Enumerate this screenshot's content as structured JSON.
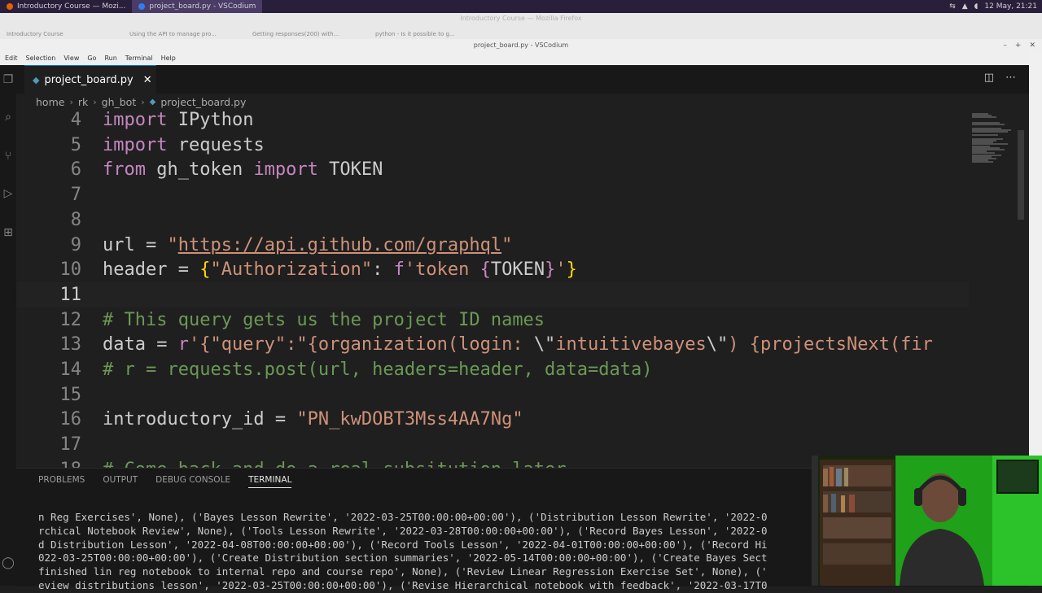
{
  "taskbar": {
    "tasks": [
      {
        "label": "Introductory Course — Mozi..."
      },
      {
        "label": "project_board.py - VSCodium"
      }
    ],
    "clock": "12 May, 21:21"
  },
  "firefox": {
    "title": "Introductory Course — Mozilla Firefox",
    "tabs": [
      {
        "label": "Introductory Course"
      },
      {
        "label": "Using the API to manage pro..."
      },
      {
        "label": "Getting responses(200) with..."
      },
      {
        "label": "python - Is it possible to g..."
      }
    ]
  },
  "window": {
    "title": "project_board.py - VSCodium"
  },
  "menu": [
    "Edit",
    "Selection",
    "View",
    "Go",
    "Run",
    "Terminal",
    "Help"
  ],
  "editor_tab": {
    "label": "project_board.py"
  },
  "breadcrumb": [
    "home",
    "rk",
    "gh_bot",
    "project_board.py"
  ],
  "code_lines": [
    {
      "n": "4",
      "tokens": [
        {
          "t": "import",
          "c": "kw"
        },
        {
          "t": " IPython",
          "c": "pl"
        }
      ]
    },
    {
      "n": "5",
      "tokens": [
        {
          "t": "import",
          "c": "kw"
        },
        {
          "t": " requests",
          "c": "pl"
        }
      ]
    },
    {
      "n": "6",
      "tokens": [
        {
          "t": "from",
          "c": "kw"
        },
        {
          "t": " gh_token ",
          "c": "pl"
        },
        {
          "t": "import",
          "c": "kw"
        },
        {
          "t": " TOKEN",
          "c": "pl"
        }
      ]
    },
    {
      "n": "7",
      "tokens": []
    },
    {
      "n": "8",
      "tokens": []
    },
    {
      "n": "9",
      "tokens": [
        {
          "t": "url = ",
          "c": "pl"
        },
        {
          "t": "\"",
          "c": "str"
        },
        {
          "t": "https://api.github.com/graphql",
          "c": "url"
        },
        {
          "t": "\"",
          "c": "str"
        }
      ]
    },
    {
      "n": "10",
      "tokens": [
        {
          "t": "header = ",
          "c": "pl"
        },
        {
          "t": "{",
          "c": "br"
        },
        {
          "t": "\"Authorization\"",
          "c": "str"
        },
        {
          "t": ": ",
          "c": "pl"
        },
        {
          "t": "f",
          "c": "kw"
        },
        {
          "t": "'token ",
          "c": "str"
        },
        {
          "t": "{",
          "c": "kw"
        },
        {
          "t": "TOKEN",
          "c": "pl"
        },
        {
          "t": "}",
          "c": "kw"
        },
        {
          "t": "'",
          "c": "str"
        },
        {
          "t": "}",
          "c": "br"
        }
      ]
    },
    {
      "n": "11",
      "tokens": [],
      "current": true
    },
    {
      "n": "12",
      "tokens": [
        {
          "t": "# This query gets us the project ID names",
          "c": "cm"
        }
      ]
    },
    {
      "n": "13",
      "tokens": [
        {
          "t": "data = ",
          "c": "pl"
        },
        {
          "t": "r",
          "c": "kw"
        },
        {
          "t": "'{\"query\":\"{organization(login: ",
          "c": "str"
        },
        {
          "t": "\\\"",
          "c": "pl"
        },
        {
          "t": "intuitivebayes",
          "c": "str"
        },
        {
          "t": "\\\"",
          "c": "pl"
        },
        {
          "t": ") {projectsNext(fir",
          "c": "str"
        }
      ]
    },
    {
      "n": "14",
      "tokens": [
        {
          "t": "# r = requests.post(url, headers=header, data=data)",
          "c": "cm"
        }
      ]
    },
    {
      "n": "15",
      "tokens": []
    },
    {
      "n": "16",
      "tokens": [
        {
          "t": "introductory_id = ",
          "c": "pl"
        },
        {
          "t": "\"PN_kwDOBT3Mss4AA7Ng\"",
          "c": "str"
        }
      ]
    },
    {
      "n": "17",
      "tokens": []
    },
    {
      "n": "18",
      "tokens": [
        {
          "t": "# Come back and do a real subsitution later",
          "c": "cm"
        }
      ]
    }
  ],
  "panel": {
    "tabs": [
      "PROBLEMS",
      "OUTPUT",
      "DEBUG CONSOLE",
      "TERMINAL"
    ],
    "active_tab": "TERMINAL",
    "terminal_lines": [
      "n Reg Exercises', None), ('Bayes Lesson Rewrite', '2022-03-25T00:00:00+00:00'), ('Distribution Lesson Rewrite', '2022-0",
      "rchical Notebook Review', None), ('Tools Lesson Rewrite', '2022-03-28T00:00:00+00:00'), ('Record Bayes Lesson', '2022-0",
      "d Distribution Lesson', '2022-04-08T00:00:00+00:00'), ('Record Tools Lesson', '2022-04-01T00:00:00+00:00'), ('Record Hi",
      "022-03-25T00:00:00+00:00'), ('Create Distribution section summaries', '2022-05-14T00:00:00+00:00'), ('Create Bayes Sect",
      "finished lin reg notebook to internal repo and course repo', None), ('Review Linear Regression Exercise Set', None), ('",
      "eview distributions lesson', '2022-03-25T00:00:00+00:00'), ('Revise Hierarchical notebook with feedback', '2022-03-17T0"
    ]
  }
}
